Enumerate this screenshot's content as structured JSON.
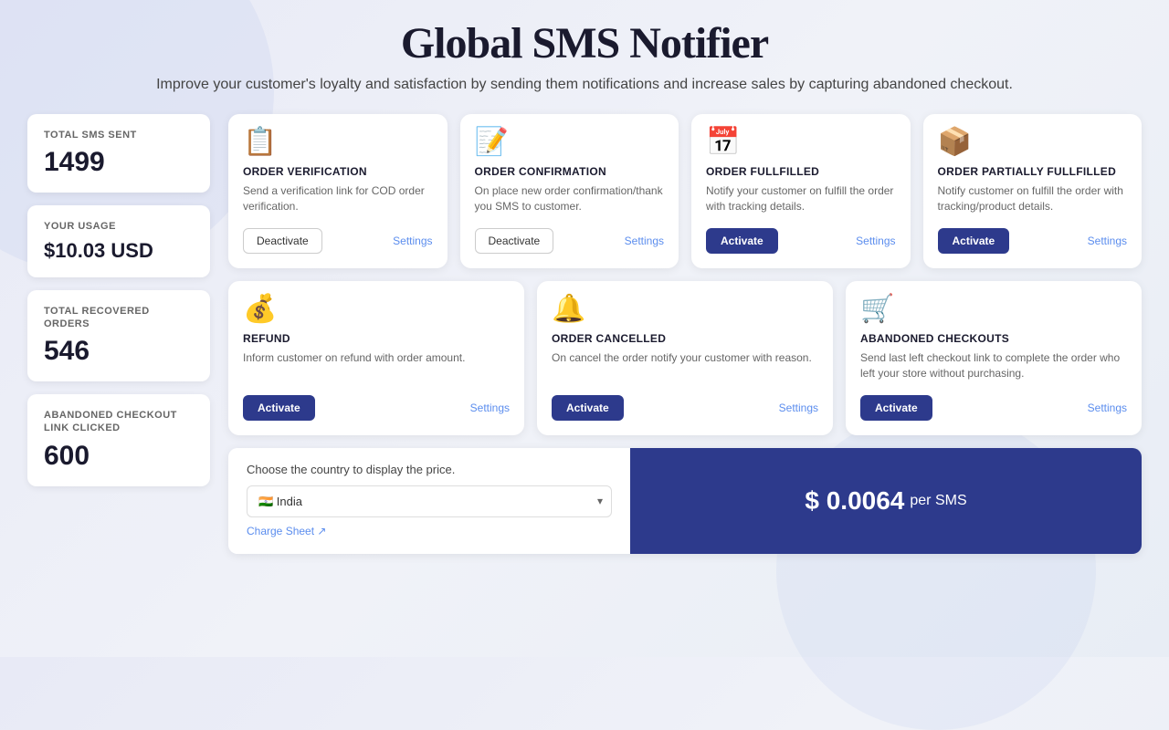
{
  "header": {
    "title": "Global SMS Notifier",
    "subtitle": "Improve your customer's loyalty and satisfaction by sending them notifications and increase sales by capturing abandoned checkout."
  },
  "stats": {
    "total_sms_sent_label": "TOTAL SMS SENT",
    "total_sms_sent_value": "1499",
    "your_usage_label": "YOUR USAGE",
    "your_usage_value": "$10.03 USD",
    "total_recovered_label": "TOTAL RECOVERED ORDERS",
    "total_recovered_value": "546",
    "abandoned_label": "ABANDONED CHECKOUT LINK CLICKED",
    "abandoned_value": "600"
  },
  "cards_row1": [
    {
      "id": "order-verification",
      "title": "ORDER VERIFICATION",
      "desc": "Send a verification link for COD order verification.",
      "icon": "📋",
      "btn_type": "deactivate",
      "btn_label": "Deactivate",
      "settings_label": "Settings"
    },
    {
      "id": "order-confirmation",
      "title": "ORDER CONFIRMATION",
      "desc": "On place new order confirmation/thank you SMS to customer.",
      "icon": "📝",
      "btn_type": "deactivate",
      "btn_label": "Deactivate",
      "settings_label": "Settings"
    },
    {
      "id": "order-fulfilled",
      "title": "ORDER FULLFILLED",
      "desc": "Notify your customer on fulfill the order with tracking details.",
      "icon": "📅",
      "btn_type": "activate",
      "btn_label": "Activate",
      "settings_label": "Settings"
    },
    {
      "id": "order-partial",
      "title": "ORDER PARTIALLY FULLFILLED",
      "desc": "Notify customer on fulfill the order with tracking/product details.",
      "icon": "📦",
      "btn_type": "activate",
      "btn_label": "Activate",
      "settings_label": "Settings"
    }
  ],
  "cards_row2": [
    {
      "id": "refund",
      "title": "REFUND",
      "desc": "Inform customer on refund with order amount.",
      "icon": "💰",
      "btn_type": "activate",
      "btn_label": "Activate",
      "settings_label": "Settings"
    },
    {
      "id": "order-cancelled",
      "title": "ORDER CANCELLED",
      "desc": "On cancel the order notify your customer with reason.",
      "icon": "🔔",
      "btn_type": "activate",
      "btn_label": "Activate",
      "settings_label": "Settings"
    },
    {
      "id": "abandoned-checkouts",
      "title": "ABANDONED CHECKOUTS",
      "desc": "Send last left checkout link to complete the order who left your store without purchasing.",
      "icon": "🛒",
      "btn_type": "activate",
      "btn_label": "Activate",
      "settings_label": "Settings"
    }
  ],
  "pricing": {
    "label": "Choose the country to display the price.",
    "country_value": "India",
    "country_flag": "🇮🇳",
    "charge_sheet_label": "Charge Sheet",
    "price": "$ 0.0064",
    "per_sms": "per SMS"
  }
}
